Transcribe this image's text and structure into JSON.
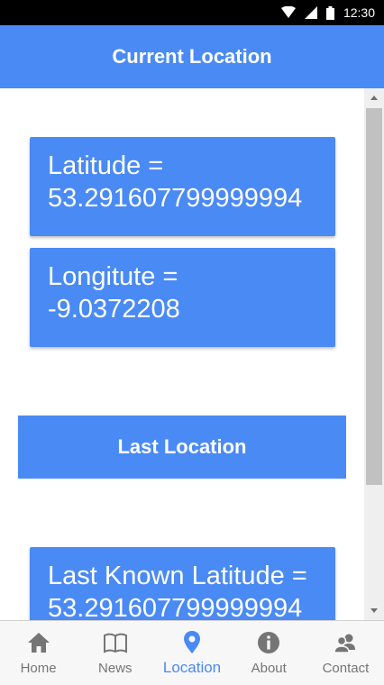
{
  "status_bar": {
    "time": "12:30"
  },
  "header": {
    "title": "Current Location"
  },
  "current": {
    "latitude_label": "Latitude =",
    "latitude_value": "53.291607799999994",
    "longitude_label": "Longitute =",
    "longitude_value": "-9.0372208"
  },
  "last_section": {
    "title": "Last Location"
  },
  "last_known": {
    "latitude_label": "Last Known Latitude =",
    "latitude_value": "53.291607799999994"
  },
  "tabs": [
    {
      "label": "Home",
      "icon": "home-icon",
      "active": false
    },
    {
      "label": "News",
      "icon": "book-icon",
      "active": false
    },
    {
      "label": "Location",
      "icon": "location-pin-icon",
      "active": true
    },
    {
      "label": "About",
      "icon": "info-icon",
      "active": false
    },
    {
      "label": "Contact",
      "icon": "contacts-icon",
      "active": false
    }
  ],
  "colors": {
    "primary": "#4a8af4",
    "tab_inactive": "#757575",
    "status_bar": "#000000"
  }
}
